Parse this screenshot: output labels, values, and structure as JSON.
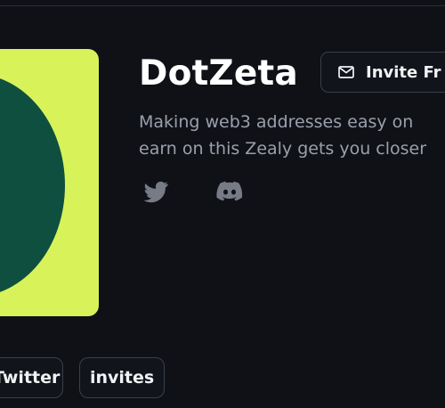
{
  "community": {
    "name": "DotZeta",
    "description_lines": [
      "Making web3 addresses easy on",
      "earn on this Zealy gets you closer"
    ]
  },
  "header": {
    "invite_button_label": "Invite Fr",
    "invite_icon": "mail-icon"
  },
  "social_links": [
    {
      "name": "Twitter",
      "icon": "twitter-icon"
    },
    {
      "name": "Discord",
      "icon": "discord-icon"
    }
  ],
  "tags": [
    {
      "label": "Twitter"
    },
    {
      "label": "invites"
    }
  ],
  "colors": {
    "background": "#0f1117",
    "logo_background": "#d8f25a",
    "logo_circle": "#0f4f3f",
    "muted_text": "#9aa0ab",
    "border": "#3a3f4a"
  }
}
